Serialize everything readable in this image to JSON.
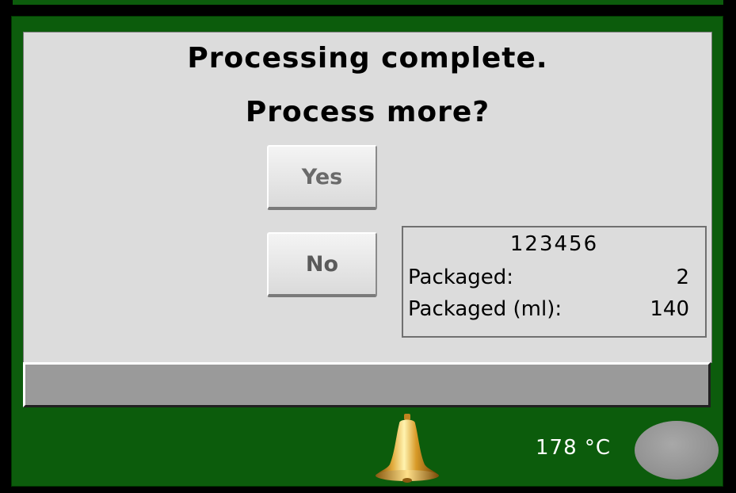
{
  "dialog": {
    "message_line_1": "Processing complete.",
    "message_line_2": "Process more?",
    "yes_label": "Yes",
    "no_label": "No"
  },
  "info_panel": {
    "batch_id": "123456",
    "packaged_label": "Packaged:",
    "packaged_value": "2",
    "packaged_ml_label": "Packaged (ml):",
    "packaged_ml_value": "140"
  },
  "progress": {
    "fraction": 0
  },
  "status_bar": {
    "bell_icon": "bell-icon",
    "temperature": "178 °C",
    "status_lamp_color": "#939393"
  },
  "colors": {
    "frame_green": "#0c5c0c",
    "dialog_gray": "#dcdcdc",
    "progress_gray": "#9a9a9a"
  }
}
